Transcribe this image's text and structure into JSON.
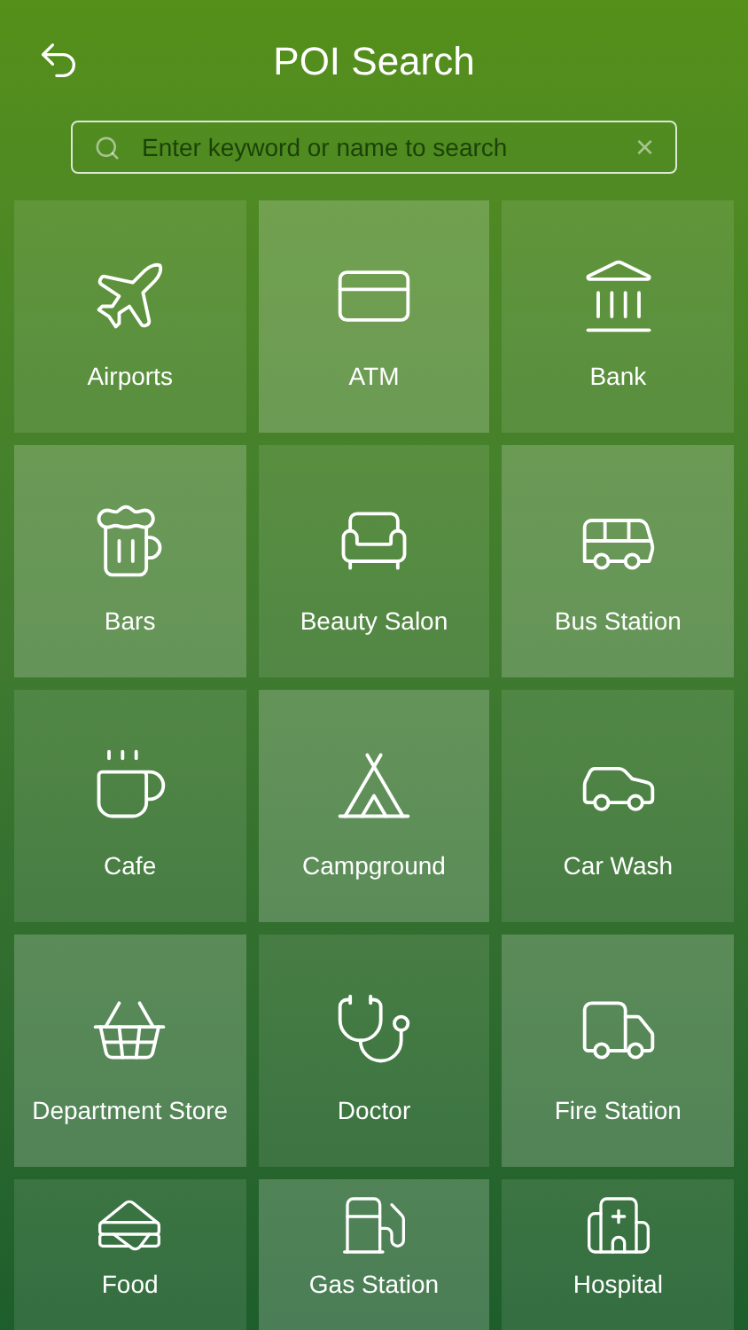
{
  "header": {
    "title": "POI Search"
  },
  "search": {
    "placeholder": "Enter keyword or name to search",
    "clear": "×"
  },
  "categories": [
    {
      "label": "Airports"
    },
    {
      "label": "ATM"
    },
    {
      "label": "Bank"
    },
    {
      "label": "Bars"
    },
    {
      "label": "Beauty Salon"
    },
    {
      "label": "Bus Station"
    },
    {
      "label": "Cafe"
    },
    {
      "label": "Campground"
    },
    {
      "label": "Car Wash"
    },
    {
      "label": "Department Store"
    },
    {
      "label": "Doctor"
    },
    {
      "label": "Fire Station"
    },
    {
      "label": "Food"
    },
    {
      "label": "Gas Station"
    },
    {
      "label": "Hospital"
    }
  ]
}
